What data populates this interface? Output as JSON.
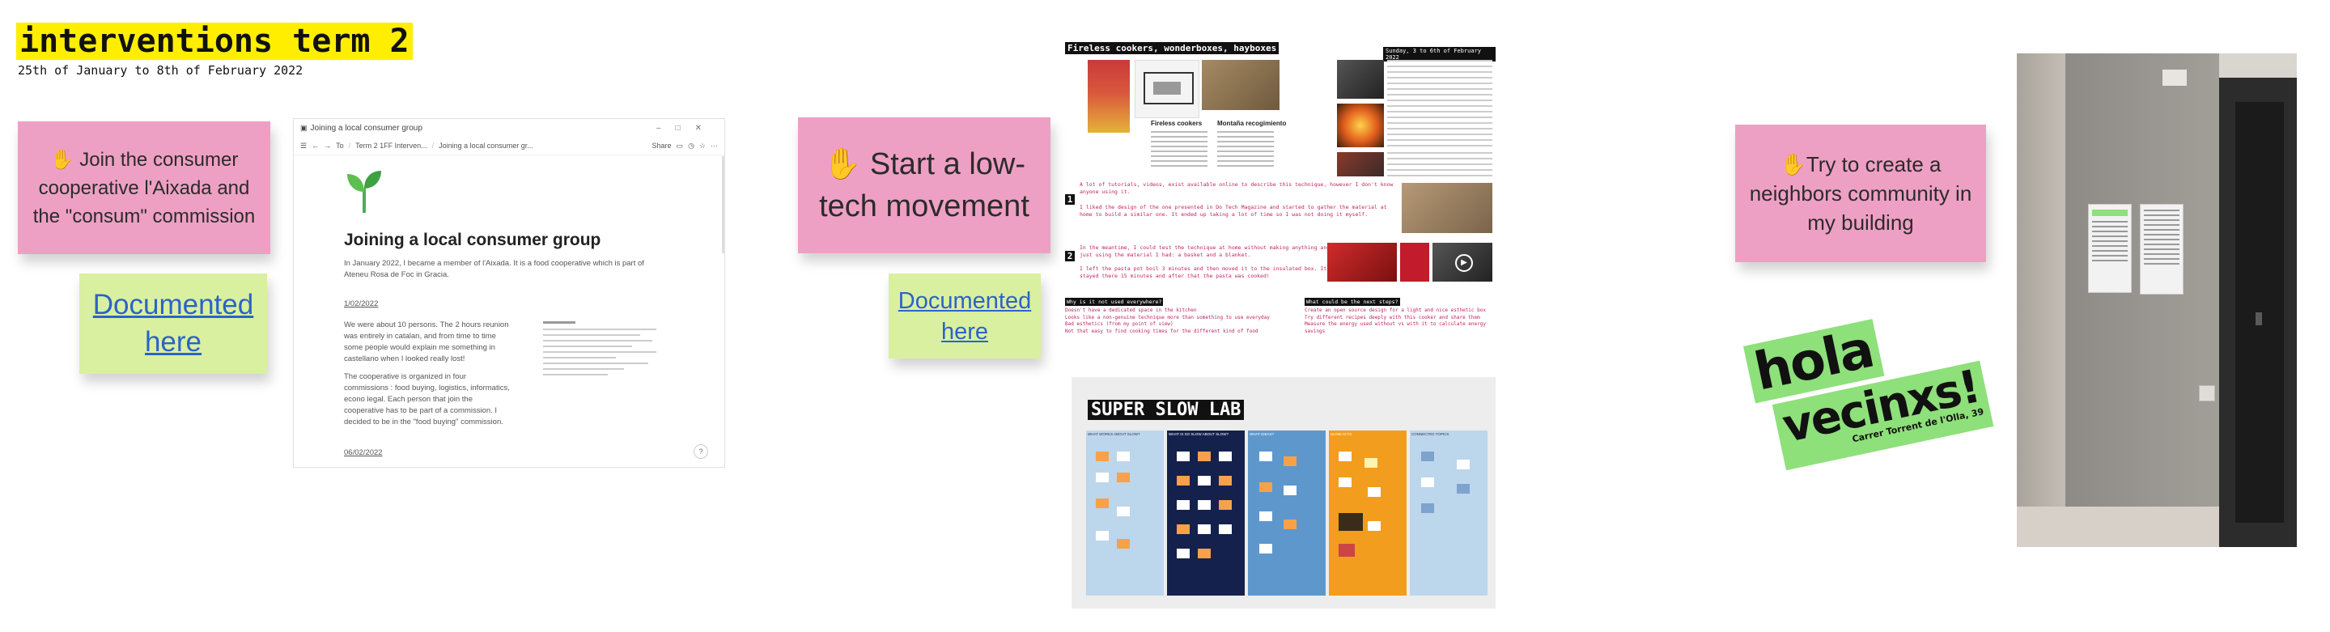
{
  "header": {
    "title": "interventions term 2",
    "subtitle": "25th of January to 8th of February 2022"
  },
  "stickies": [
    {
      "emoji": "✋",
      "text": "Join the consumer cooperative l'Aixada and the \"consum\" commission"
    },
    {
      "emoji": "✋",
      "text": "Start a low-tech movement"
    },
    {
      "emoji": "✋",
      "text": "Try to create a neighbors community in my building"
    }
  ],
  "links": [
    {
      "text": "Documented here"
    },
    {
      "text": "Documented here"
    }
  ],
  "notion_window": {
    "window_title": "Joining a local consumer group",
    "breadcrumb": [
      "To",
      "Term 2 1FF Interven...",
      "Joining a local consumer gr..."
    ],
    "share_label": "Share",
    "page_title": "Joining a local consumer group",
    "intro": "In January 2022, I became a member of l'Aixada. It is a food cooperative which is part of Ateneu Rosa de Foc in Gracia.",
    "date1": "1/02/2022",
    "para1": "We were about 10 persons. The 2 hours reunion was entirely in catalan, and from time to time some people would explain me something in castellano when I looked really lost!",
    "para2": "The cooperative is organized in four commissions : food buying, logistics, informatics, econo legal. Each person that join the cooperative has to be part of a commission. I decided to be in the \"food buying\" commission.",
    "date2": "06/02/2022",
    "help": "?"
  },
  "lowtech_slide": {
    "title": "Fireless cookers, wonderboxes, hayboxes",
    "date_badge": "Sunday, 3 to 6th of February 2022",
    "card1_title": "Fireless cookers",
    "card2_title": "Montaña recogimiento",
    "step1": "A lot of tutorials, videos, exist available online to describe this technique, however I don't know anyone using it.",
    "step1_b": "I liked the design of the one presented in Do Tech Magazine and started to gather the material at home to build a similar one. It ended up taking a lot of time so I was not doing it myself.",
    "step2": "In the meantime, I could test the technique at home without making anything and just using the material I had: a basket and a blanket.",
    "step2_b": "I left the pasta pot boil 3 minutes and then moved it to the insulated box. It stayed there 15 minutes and after that the pasta was cooked!",
    "why_title": "Why is it not used everywhere?",
    "why_items": [
      "Doesn't have a dedicated space in the kitchen",
      "Looks like a non-genuine technique more than something to use everyday",
      "Bad esthetics (from my point of view)",
      "Not that easy to find cooking times for the different kind of food"
    ],
    "next_title": "What could be the next steps?",
    "next_items": [
      "Create an open source design for a light and nice esthetic box",
      "Try different recipes deeply with this cooker and share them",
      "Measure the energy used without vs with it to calculate energy savings"
    ],
    "labels": [
      "1",
      "2"
    ]
  },
  "slow_lab": {
    "title": "SUPER SLOW LAB",
    "columns": [
      "WHAT WORKS ABOUT SLOW?",
      "WHAT IS SO SLOW ABOUT SLOW?",
      "WHAT IDEAS?",
      "SLOW ACTS",
      "CONNECTED TOPICS"
    ]
  },
  "sticker": {
    "line1": "hola",
    "line2": "vecinxs!",
    "address": "Carrer Torrent de l'Olla, 39"
  },
  "colors": {
    "title_highlight": "#ffee00",
    "sticky_pink": "#eea0c4",
    "link_note": "#d9f0a0",
    "sticker_green": "#8ee07a",
    "link": "#2c63c9"
  }
}
